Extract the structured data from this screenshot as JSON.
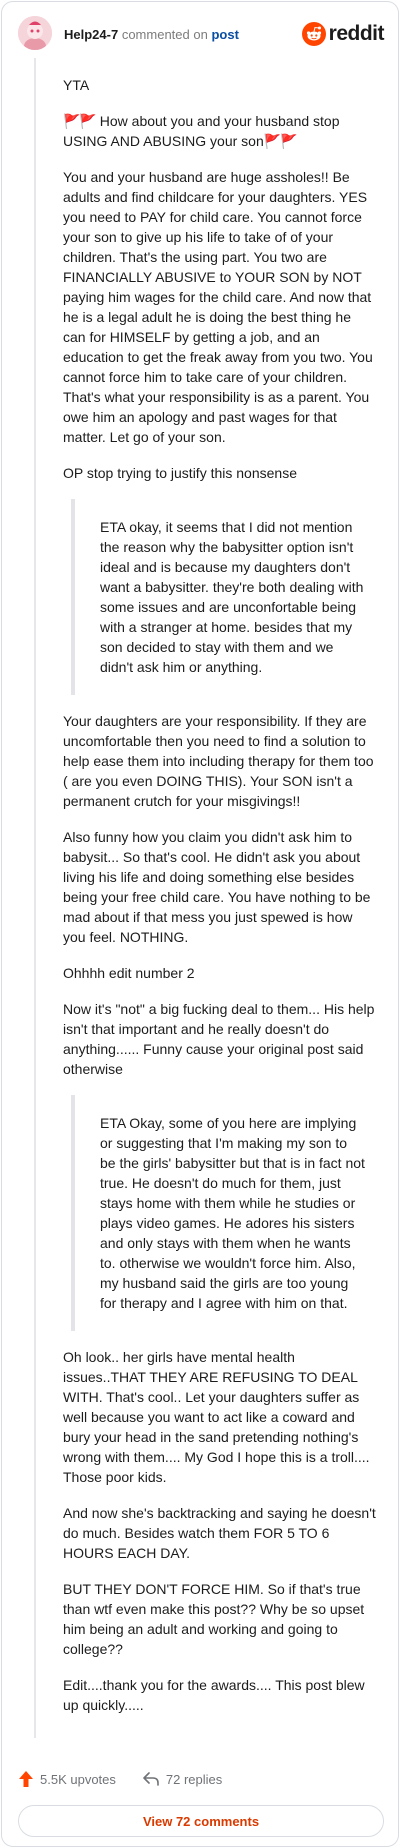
{
  "header": {
    "username": "Help24-7",
    "action_text": "commented on",
    "post_link": "post",
    "brand_name": "reddit",
    "brand_color": "#ff4500"
  },
  "comment": {
    "p1": "YTA",
    "p2_flag_left": "🚩🚩",
    "p2_text": " How about you and your husband stop USING AND ABUSING your son",
    "p2_flag_right": "🚩🚩",
    "p3": "You and your husband are huge assholes!! Be adults and find childcare for your daughters. YES you need to PAY for child care. You cannot force your son to give up his life to take of of your children. That's the using part. You two are FINANCIALLY ABUSIVE to YOUR SON by NOT paying him wages for the child care. And now that he is a legal adult he is doing the best thing he can for HIMSELF by getting a job, and an education to get the freak away from you two. You cannot force him to take care of your children. That's what your responsibility is as a parent. You owe him an apology and past wages for that matter. Let go of your son.",
    "p4": "OP stop trying to justify this nonsense",
    "quote1": "ETA okay, it seems that I did not mention the reason why the babysitter option isn't ideal and is because my daughters don't want a babysitter. they're both dealing with some issues and are unconfortable being with a stranger at home. besides that my son decided to stay with them and we didn't ask him or anything.",
    "p5": "Your daughters are your responsibility. If they are uncomfortable then you need to find a solution to help ease them into including therapy for them too ( are you even DOING THIS). Your SON isn't a permanent crutch for your misgivings!!",
    "p6": "Also funny how you claim you didn't ask him to babysit... So that's cool. He didn't ask you about living his life and doing something else besides being your free child care. You have nothing to be mad about if that mess you just spewed is how you feel. NOTHING.",
    "p7": "Ohhhh edit number 2",
    "p8": "Now it's \"not\" a big fucking deal to them... His help isn't that important and he really doesn't do anything...... Funny cause your original post said otherwise",
    "quote2": "ETA Okay, some of you here are implying or suggesting that I'm making my son to be the girls' babysitter but that is in fact not true. He doesn't do much for them, just stays home with them while he studies or plays video games. He adores his sisters and only stays with them when he wants to. otherwise we wouldn't force him. Also, my husband said the girls are too young for therapy and I agree with him on that.",
    "p9": "Oh look.. her girls have mental health issues..THAT THEY ARE REFUSING TO DEAL WITH. That's cool.. Let your daughters suffer as well because you want to act like a coward and bury your head in the sand pretending nothing's wrong with them.... My God I hope this is a troll.... Those poor kids.",
    "p10": "And now she's backtracking and saying he doesn't do much. Besides watch them FOR 5 TO 6 HOURS EACH DAY.",
    "p11": "BUT THEY DON'T FORCE HIM. So if that's true than wtf even make this post?? Why be so upset him being an adult and working and going to college??",
    "p12": "Edit....thank you for the awards.... This post blew up quickly....."
  },
  "footer": {
    "upvotes": "5.5K upvotes",
    "replies": "72 replies",
    "view_button": "View 72 comments",
    "upvote_color": "#ff4500"
  },
  "icons": {
    "avatar": "snoo-avatar-icon",
    "brand": "reddit-logo-icon",
    "upvote": "upvote-arrow-icon",
    "reply": "reply-arrow-icon"
  }
}
